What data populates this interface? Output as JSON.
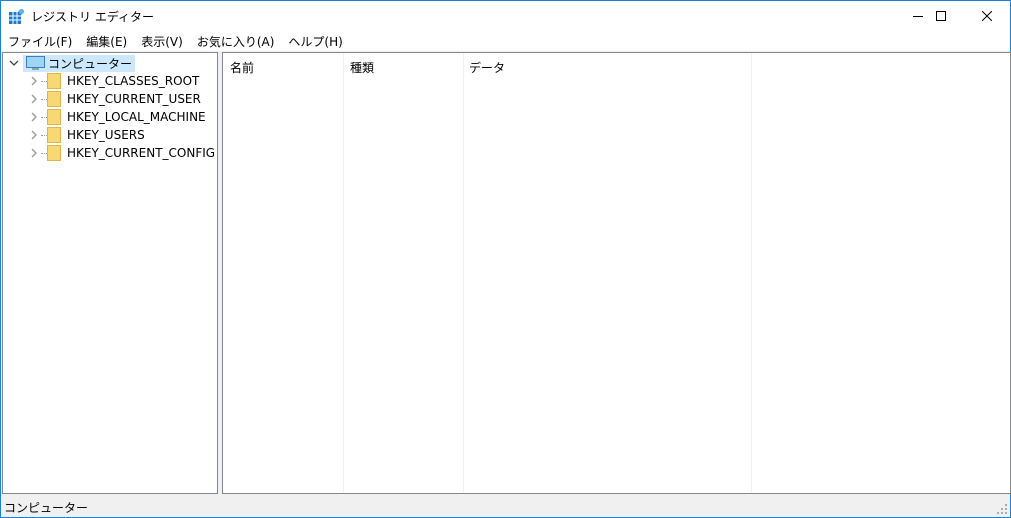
{
  "window": {
    "title": "レジストリ エディター",
    "border_color": "#1883d7"
  },
  "caption": {
    "minimize": "minimize-icon",
    "maximize": "maximize-icon",
    "close": "close-icon"
  },
  "menu": [
    "ファイル(F)",
    "編集(E)",
    "表示(V)",
    "お気に入り(A)",
    "ヘルプ(H)"
  ],
  "tree": {
    "root": "コンピューター",
    "keys": [
      "HKEY_CLASSES_ROOT",
      "HKEY_CURRENT_USER",
      "HKEY_LOCAL_MACHINE",
      "HKEY_USERS",
      "HKEY_CURRENT_CONFIG"
    ]
  },
  "list": {
    "columns": [
      "名前",
      "種類",
      "データ"
    ]
  },
  "status": {
    "text": "コンピューター"
  }
}
